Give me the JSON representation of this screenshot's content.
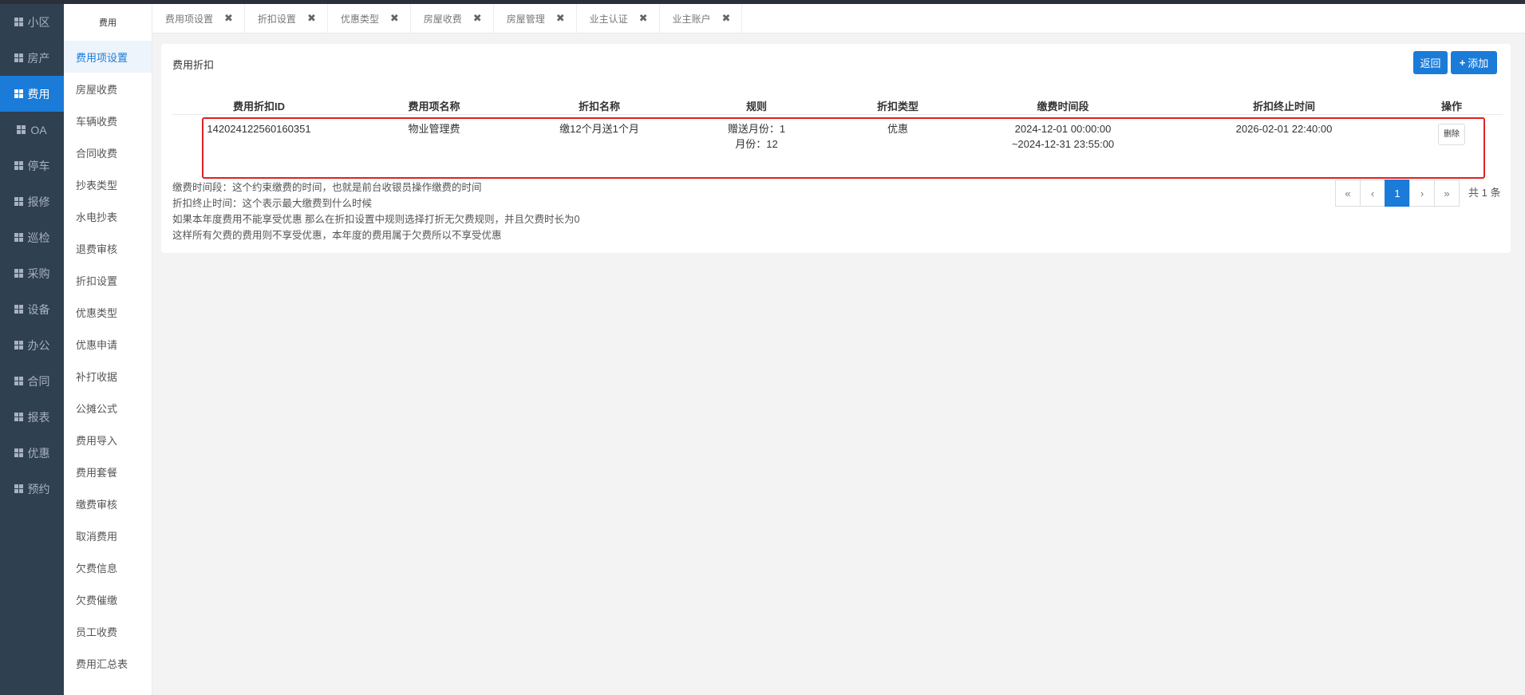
{
  "nav": {
    "items": [
      {
        "label": "小区"
      },
      {
        "label": "房产"
      },
      {
        "label": "费用"
      },
      {
        "label": "OA"
      },
      {
        "label": "停车"
      },
      {
        "label": "报修"
      },
      {
        "label": "巡检"
      },
      {
        "label": "采购"
      },
      {
        "label": "设备"
      },
      {
        "label": "办公"
      },
      {
        "label": "合同"
      },
      {
        "label": "报表"
      },
      {
        "label": "优惠"
      },
      {
        "label": "预约"
      }
    ],
    "active_index": 2
  },
  "subnav": {
    "header": "费用",
    "items": [
      {
        "label": "费用项设置"
      },
      {
        "label": "房屋收费"
      },
      {
        "label": "车辆收费"
      },
      {
        "label": "合同收费"
      },
      {
        "label": "抄表类型"
      },
      {
        "label": "水电抄表"
      },
      {
        "label": "退费审核"
      },
      {
        "label": "折扣设置"
      },
      {
        "label": "优惠类型"
      },
      {
        "label": "优惠申请"
      },
      {
        "label": "补打收据"
      },
      {
        "label": "公摊公式"
      },
      {
        "label": "费用导入"
      },
      {
        "label": "费用套餐"
      },
      {
        "label": "缴费审核"
      },
      {
        "label": "取消费用"
      },
      {
        "label": "欠费信息"
      },
      {
        "label": "欠费催缴"
      },
      {
        "label": "员工收费"
      },
      {
        "label": "费用汇总表"
      }
    ],
    "active_index": 0
  },
  "tabs": [
    {
      "label": "费用项设置",
      "close": "✖"
    },
    {
      "label": "折扣设置",
      "close": "✖"
    },
    {
      "label": "优惠类型",
      "close": "✖"
    },
    {
      "label": "房屋收费",
      "close": "✖"
    },
    {
      "label": "房屋管理",
      "close": "✖"
    },
    {
      "label": "业主认证",
      "close": "✖"
    },
    {
      "label": "业主账户",
      "close": "✖"
    }
  ],
  "card": {
    "title": "费用折扣",
    "back_label": "返回",
    "add_label": "添加",
    "add_icon": "+"
  },
  "table": {
    "headers": [
      "费用折扣ID",
      "费用项名称",
      "折扣名称",
      "规则",
      "折扣类型",
      "缴费时间段",
      "折扣终止时间",
      "操作"
    ],
    "rows": [
      {
        "id": "142024122560160351",
        "fee_item": "物业管理费",
        "discount_name": "缴12个月送1个月",
        "rule_line1": "赠送月份：1",
        "rule_line2": "月份：12",
        "discount_type": "优惠",
        "period_line1": "2024-12-01 00:00:00",
        "period_line2": "~2024-12-31 23:55:00",
        "end_time": "2026-02-01 22:40:00",
        "action": "删除"
      }
    ]
  },
  "notes": [
    "缴费时间段：这个约束缴费的时间，也就是前台收银员操作缴费的时间",
    "折扣终止时间：这个表示最大缴费到什么时候",
    "如果本年度费用不能享受优惠 那么在折扣设置中规则选择打折无欠费规则，并且欠费时长为0",
    "这样所有欠费的费用则不享受优惠，本年度的费用属于欠费所以不享受优惠"
  ],
  "pagination": {
    "first": "«",
    "prev": "‹",
    "current": "1",
    "next": "›",
    "last": "»",
    "total": "共 1 条"
  },
  "colors": {
    "accent": "#1a7bd9",
    "nav_bg": "#2f4050",
    "highlight": "#e02020"
  }
}
